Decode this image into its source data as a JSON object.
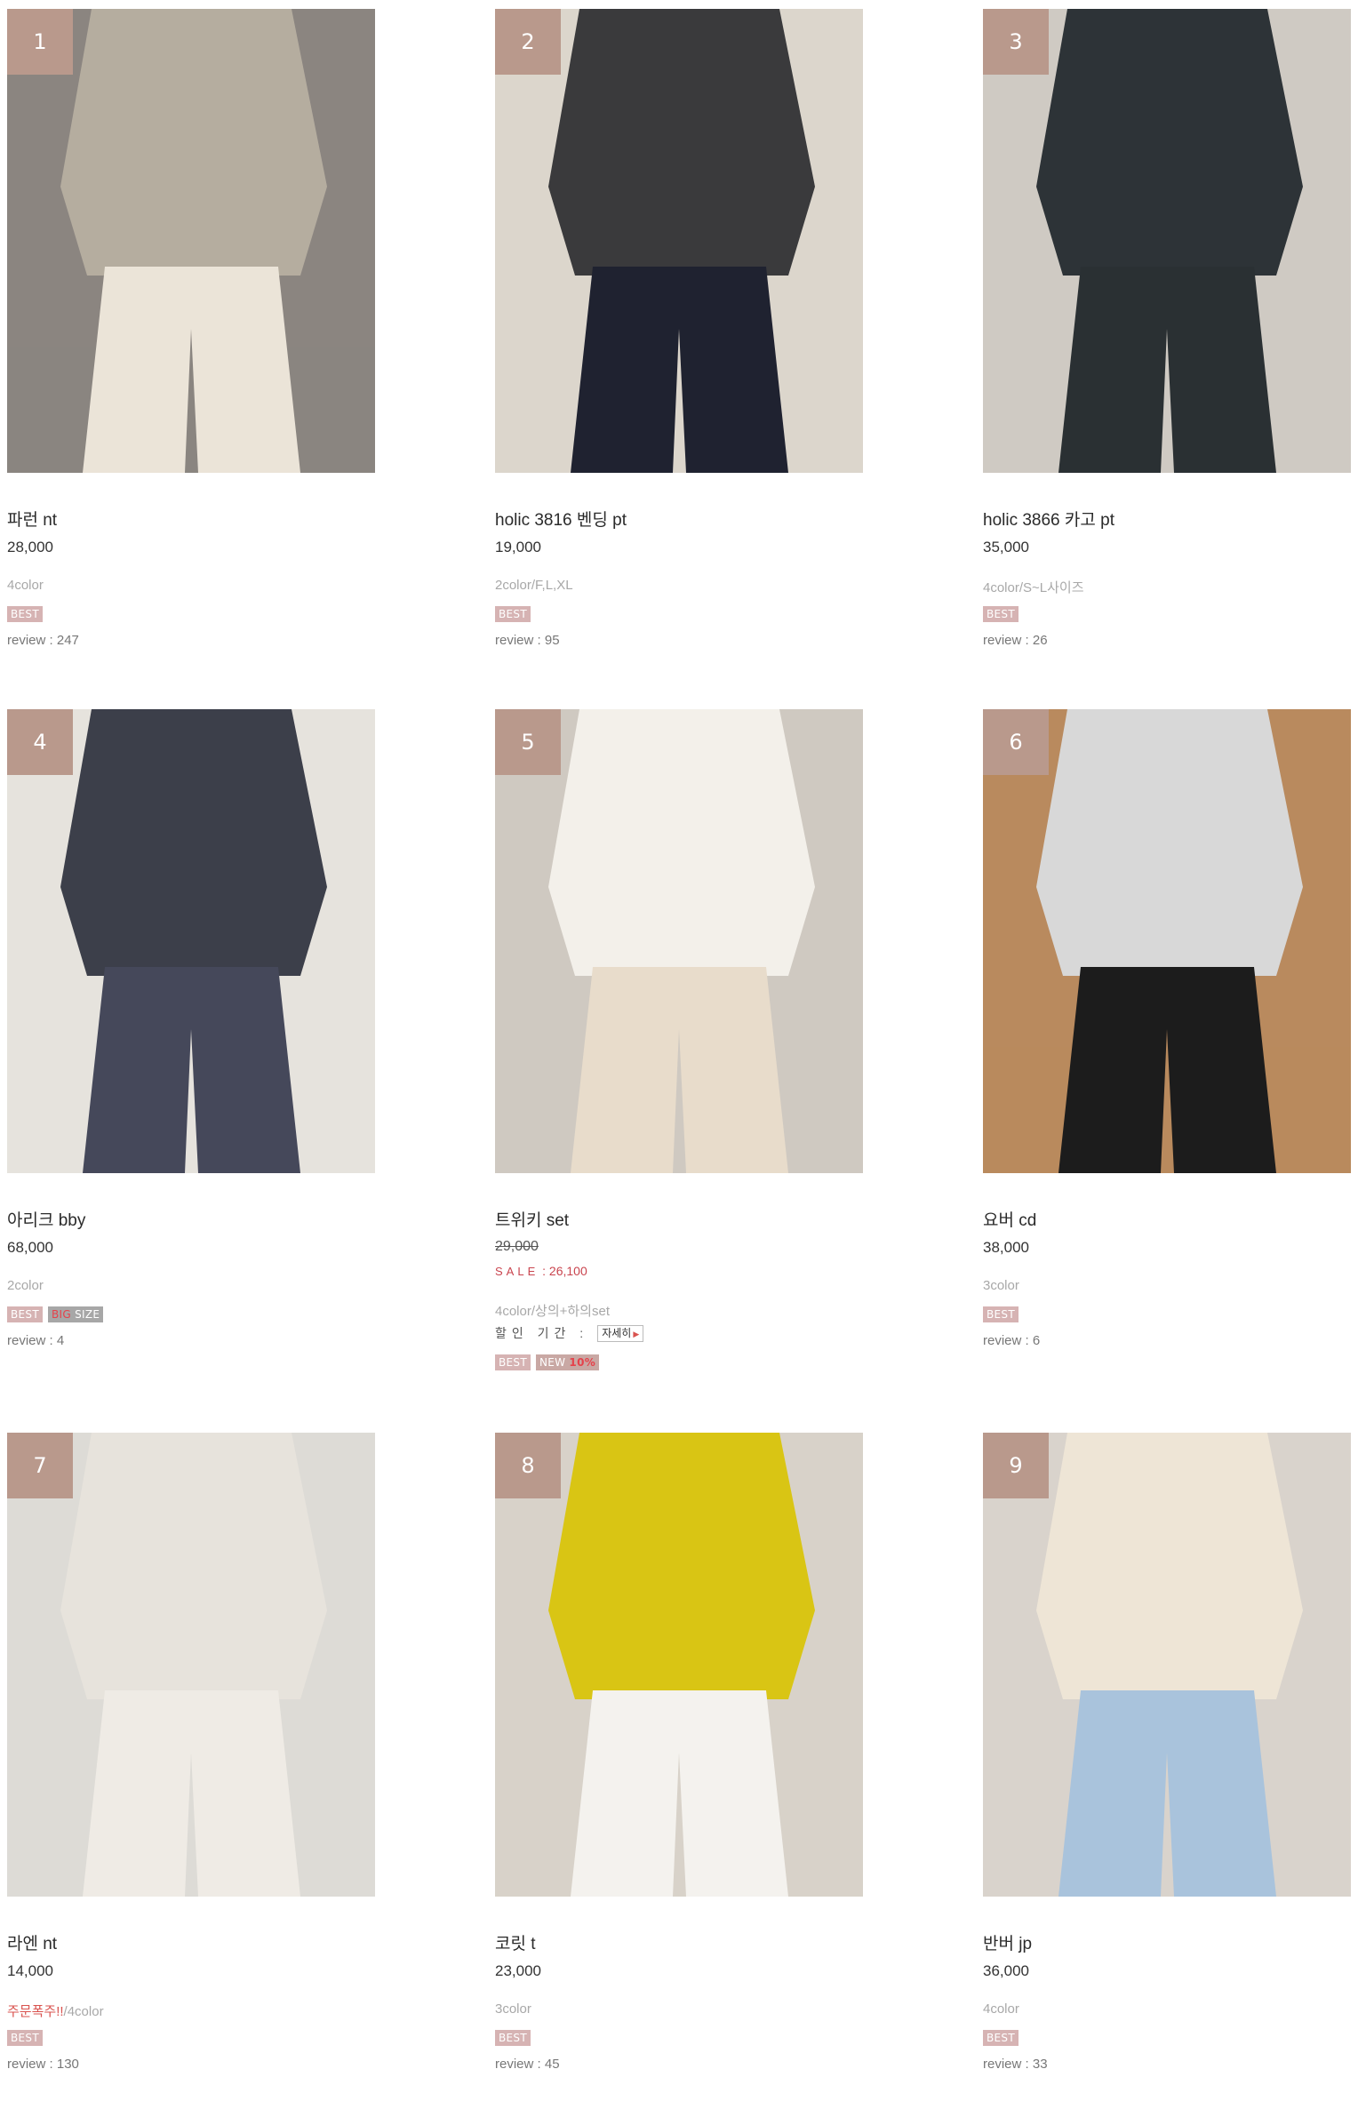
{
  "products": [
    {
      "rank": "1",
      "name": "파런 nt",
      "price": "28,000",
      "option": "4color",
      "badges": [
        "BEST"
      ],
      "review": "review : 247",
      "photo": {
        "bg": "#8b8580",
        "top": "#b5ad9f",
        "bottom": "#ebe4d8"
      }
    },
    {
      "rank": "2",
      "name": "holic 3816 벤딩 pt",
      "price": "19,000",
      "option": "2color/F,L,XL",
      "badges": [
        "BEST"
      ],
      "review": "review : 95",
      "photo": {
        "bg": "#dcd6cc",
        "top": "#3a3a3c",
        "bottom": "#1f2230"
      }
    },
    {
      "rank": "3",
      "name": "holic 3866 카고 pt",
      "price": "35,000",
      "option": "4color/S~L사이즈",
      "badges": [
        "BEST"
      ],
      "review": "review : 26",
      "photo": {
        "bg": "#cfcac3",
        "top": "#2d3337",
        "bottom": "#2a3033"
      }
    },
    {
      "rank": "4",
      "name": "아리크 bby",
      "price": "68,000",
      "option": "2color",
      "badges": [
        "BEST",
        "BIG SIZE"
      ],
      "review": "review : 4",
      "photo": {
        "bg": "#e6e3dd",
        "top": "#3c3f4a",
        "bottom": "#45485a"
      }
    },
    {
      "rank": "5",
      "name": "트위키 set",
      "original_price": "29,000",
      "sale_label": "SALE",
      "sale_price": "26,100",
      "option": "4color/상의+하의set",
      "period_label": "할인 기간 :",
      "detail_button": "자세히",
      "badges": [
        "BEST",
        "NEW 10%"
      ],
      "photo": {
        "bg": "#cfc9c1",
        "top": "#f3f0ea",
        "bottom": "#e8dccb"
      }
    },
    {
      "rank": "6",
      "name": "요버 cd",
      "price": "38,000",
      "option": "3color",
      "badges": [
        "BEST"
      ],
      "review": "review : 6",
      "photo": {
        "bg": "#b98a5e",
        "top": "#d8d8d8",
        "bottom": "#1c1c1c"
      }
    },
    {
      "rank": "7",
      "name": "라엔 nt",
      "price": "14,000",
      "option_highlight": "주문폭주!!",
      "option": "/4color",
      "badges": [
        "BEST"
      ],
      "review": "review : 130",
      "photo": {
        "bg": "#dddbd6",
        "top": "#e7e3dc",
        "bottom": "#efebe5"
      }
    },
    {
      "rank": "8",
      "name": "코릿 t",
      "price": "23,000",
      "option": "3color",
      "badges": [
        "BEST"
      ],
      "review": "review : 45",
      "photo": {
        "bg": "#d8d2c9",
        "top": "#d9c514",
        "bottom": "#f4f2ee"
      }
    },
    {
      "rank": "9",
      "name": "반버 jp",
      "price": "36,000",
      "option": "4color",
      "badges": [
        "BEST"
      ],
      "review": "review : 33",
      "photo": {
        "bg": "#d9d3cc",
        "top": "#eee5d6",
        "bottom": "#a9c3dc"
      }
    }
  ]
}
